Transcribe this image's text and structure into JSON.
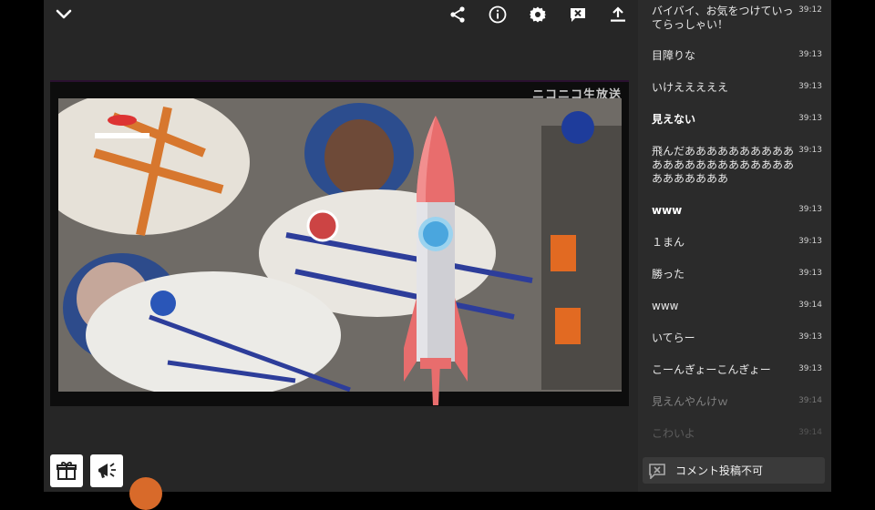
{
  "player": {
    "watermark": "ニコニコ生放送",
    "icons": [
      "chevron-down-icon",
      "share-icon",
      "info-icon",
      "settings-gear-icon",
      "close-comments-icon",
      "upload-icon"
    ]
  },
  "bottom_buttons": [
    "gift-icon",
    "megaphone-icon"
  ],
  "comments": [
    {
      "text": "バイバイ、お気をつけていってらっしゃい！",
      "time": "39:12"
    },
    {
      "text": "目障りな",
      "time": "39:13"
    },
    {
      "text": "いけえええええ",
      "time": "39:13"
    },
    {
      "text": "見えない",
      "time": "39:13"
    },
    {
      "text": "飛んだああああああああああああああああああああああああああああああ",
      "time": "39:13"
    },
    {
      "text": "www",
      "time": "39:13"
    },
    {
      "text": "１まん",
      "time": "39:13"
    },
    {
      "text": "勝った",
      "time": "39:13"
    },
    {
      "text": "www",
      "time": "39:14"
    },
    {
      "text": "いてらー",
      "time": "39:13"
    },
    {
      "text": "こーんぎょーこんぎょー",
      "time": "39:13"
    },
    {
      "text": "見えんやんけｗ",
      "time": "39:14"
    },
    {
      "text": "こわいよ",
      "time": "39:14"
    }
  ],
  "status": {
    "label": "コメント投稿不可"
  },
  "colors": {
    "panel": "#2b2b2b",
    "player": "#262626",
    "rocket_body": "#e86d6d",
    "window": "#4aa6de"
  }
}
